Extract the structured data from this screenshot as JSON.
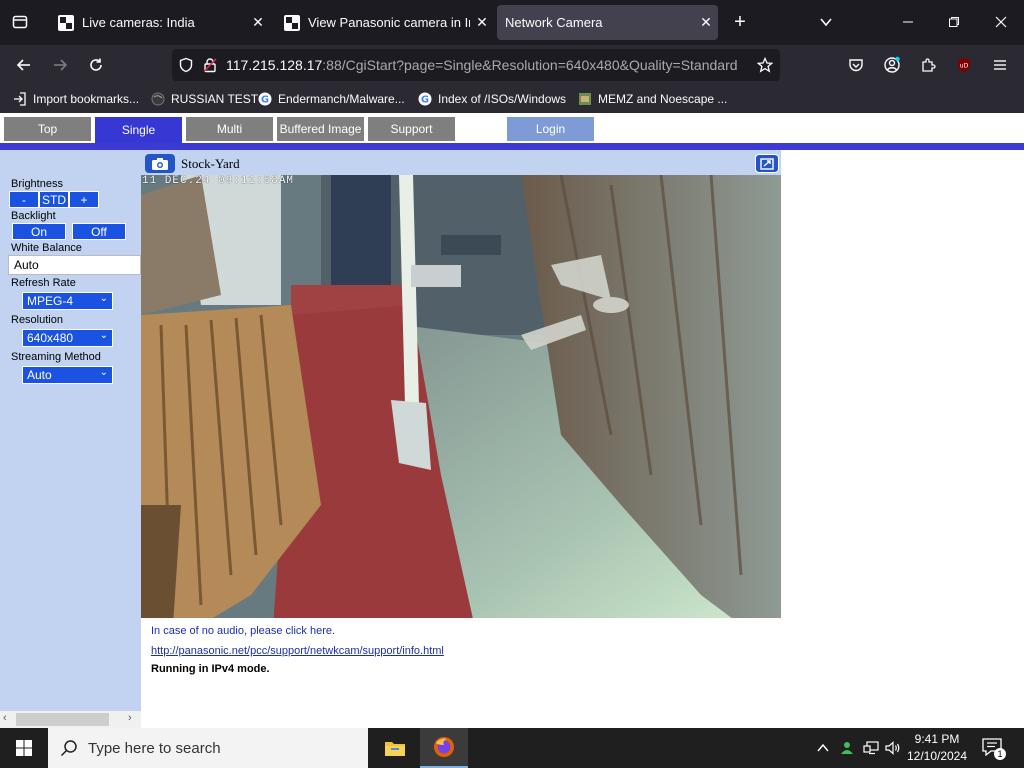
{
  "browser": {
    "tabs": [
      {
        "label": "Live cameras: India",
        "active": false
      },
      {
        "label": "View Panasonic camera in India",
        "active": false
      },
      {
        "label": "Network Camera",
        "active": true
      }
    ],
    "url_host": "117.215.128.17",
    "url_rest": ":88/CgiStart?page=Single&Resolution=640x480&Quality=Standard",
    "bookmarks": [
      {
        "label": "Import bookmarks...",
        "icon": "import-icon"
      },
      {
        "label": "RUSSIAN TEST",
        "icon": "globe-icon"
      },
      {
        "label": "Endermanch/Malware...",
        "icon": "google-icon"
      },
      {
        "label": "Index of /ISOs/Windows",
        "icon": "google-icon"
      },
      {
        "label": "MEMZ and Noescape ...",
        "icon": "image-icon"
      }
    ]
  },
  "camera_page": {
    "nav": {
      "top": "Top",
      "single": "Single",
      "multi": "Multi",
      "buffered": "Buffered Image",
      "support": "Support",
      "login": "Login"
    },
    "controls": {
      "brightness_label": "Brightness",
      "brightness_minus": "-",
      "brightness_std": "STD",
      "brightness_plus": "+",
      "backlight_label": "Backlight",
      "backlight_on": "On",
      "backlight_off": "Off",
      "white_balance_label": "White Balance",
      "white_balance_value": "Auto",
      "refresh_rate_label": "Refresh Rate",
      "refresh_rate_value": "MPEG-4",
      "resolution_label": "Resolution",
      "resolution_value": "640x480",
      "streaming_label": "Streaming Method",
      "streaming_value": "Auto"
    },
    "camera_title": "Stock-Yard",
    "timestamp": "11 DEC.24 09:11:58AM",
    "audio_note": "In case of no audio, please click here.",
    "support_link": "http://panasonic.net/pcc/support/netwkcam/support/info.html",
    "mode_note": "Running in IPv4 mode."
  },
  "taskbar": {
    "search_placeholder": "Type here to search",
    "time": "9:41 PM",
    "date": "12/10/2024",
    "notification_count": "1"
  }
}
